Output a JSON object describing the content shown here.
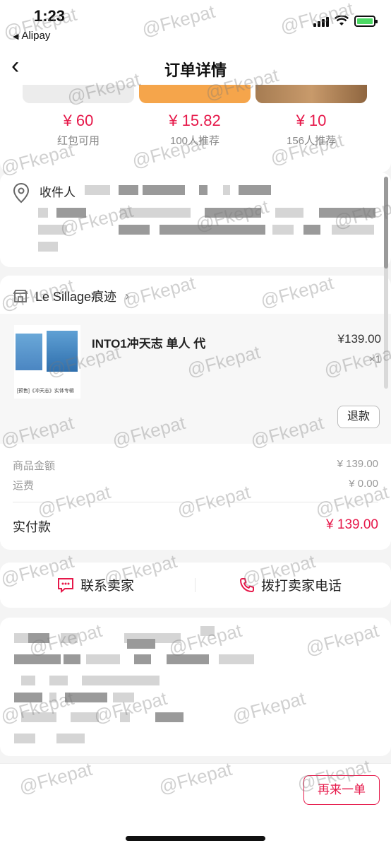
{
  "status_bar": {
    "time": "1:23",
    "back_app": "Alipay",
    "back_arrow": "◀"
  },
  "nav": {
    "back_icon": "‹",
    "title": "订单详情"
  },
  "recommendations": [
    {
      "price": "¥ 60",
      "subtitle": "红包可用"
    },
    {
      "price": "¥ 15.82",
      "subtitle": "100人推荐"
    },
    {
      "price": "¥ 10",
      "subtitle": "156人推荐"
    }
  ],
  "address": {
    "label": "收件人"
  },
  "shop": {
    "name": "Le Sillage痕迹",
    "arrow": "›",
    "item": {
      "title": "INTO1冲天志 单人 代",
      "price": "¥139.00",
      "quantity": "×1",
      "thumb_caption": "[预售]《冲天志》实体专辑",
      "refund_label": "退款"
    }
  },
  "amounts": {
    "goods_label": "商品金额",
    "goods_value": "¥ 139.00",
    "shipping_label": "运费",
    "shipping_value": "¥ 0.00",
    "paid_label": "实付款",
    "paid_value": "¥ 139.00"
  },
  "contact": {
    "chat_label": "联系卖家",
    "call_label": "拨打卖家电话"
  },
  "bottom": {
    "again_label": "再来一单"
  },
  "watermark": "@Fkepat",
  "colors": {
    "accent": "#e6184a",
    "background": "#f4f4f4"
  }
}
